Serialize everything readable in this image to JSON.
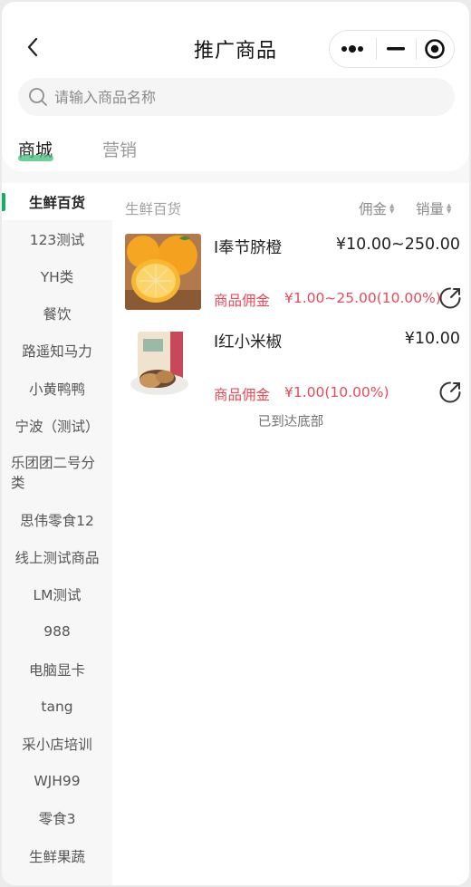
{
  "header": {
    "title": "推广商品",
    "search_placeholder": "请输入商品名称",
    "tabs": [
      {
        "label": "商城",
        "active": true
      },
      {
        "label": "营销",
        "active": false
      }
    ]
  },
  "sidebar": {
    "items": [
      {
        "label": "生鲜百货",
        "active": true
      },
      {
        "label": "123测试"
      },
      {
        "label": "YH类"
      },
      {
        "label": "餐饮"
      },
      {
        "label": "路遥知马力"
      },
      {
        "label": "小黄鸭鸭"
      },
      {
        "label": "宁波（测试）"
      },
      {
        "label": "乐团团二号分类"
      },
      {
        "label": "思伟零食12"
      },
      {
        "label": "线上测试商品"
      },
      {
        "label": "LM测试"
      },
      {
        "label": "988"
      },
      {
        "label": "电脑显卡"
      },
      {
        "label": "tang"
      },
      {
        "label": "采小店培训"
      },
      {
        "label": "WJH99"
      },
      {
        "label": "零食3"
      },
      {
        "label": "生鲜果蔬"
      }
    ]
  },
  "content": {
    "category_title": "生鲜百货",
    "sort_commission": "佣金",
    "sort_sales": "销量",
    "products": [
      {
        "name": "I奉节脐橙",
        "price": "¥10.00~250.00",
        "commission_label": "商品佣金",
        "commission": "¥1.00~25.00(10.00%)"
      },
      {
        "name": "I红小米椒",
        "price": "¥10.00",
        "commission_label": "商品佣金",
        "commission": "¥1.00(10.00%)"
      }
    ],
    "end_text": "已到达底部"
  },
  "colors": {
    "accent_green": "#1aab63",
    "commission_red": "#e84a5a"
  }
}
